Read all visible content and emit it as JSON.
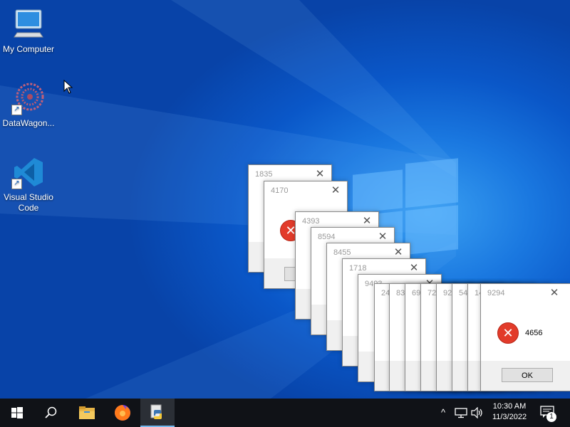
{
  "desktop": {
    "icons": [
      {
        "label": "My Computer",
        "icon": "computer-icon"
      },
      {
        "label": "DataWagon...",
        "icon": "datawagon-icon"
      },
      {
        "label": "Visual Studio Code",
        "icon": "vscode-icon"
      }
    ]
  },
  "dialogs": [
    {
      "title": "1835"
    },
    {
      "title": "4170"
    },
    {
      "title": "4393"
    },
    {
      "title": "8594"
    },
    {
      "title": "8455"
    },
    {
      "title": "1718"
    },
    {
      "title": "9493"
    },
    {
      "title": "24"
    },
    {
      "title": "83"
    },
    {
      "title": "69"
    },
    {
      "title": "72"
    },
    {
      "title": "92"
    },
    {
      "title": "54"
    },
    {
      "title": "14"
    },
    {
      "title": "9294",
      "message": "4656",
      "ok_label": "OK"
    }
  ],
  "taskbar": {
    "items": [
      "start-icon",
      "search-icon",
      "file-explorer-icon",
      "firefox-icon",
      "python-app-icon"
    ],
    "clock": {
      "time": "10:30 AM",
      "date": "11/3/2022"
    },
    "notification_count": "1"
  },
  "colors": {
    "taskbar": "#101217",
    "error": "#e23b2a",
    "desktop": "#0a57c8"
  }
}
